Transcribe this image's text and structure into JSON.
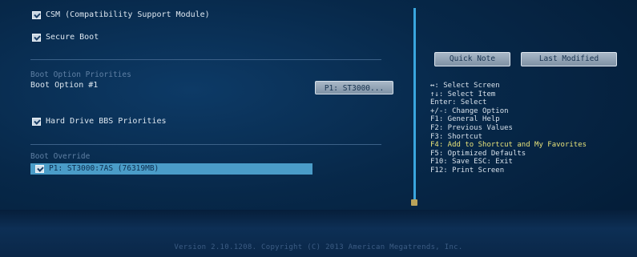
{
  "boot_menu": {
    "csm_label": "CSM (Compatibility Support Module)",
    "secure_boot_label": "Secure Boot",
    "priorities_heading": "Boot Option Priorities",
    "boot_option_1_label": "Boot Option #1",
    "boot_option_1_value": "P1: ST3000...",
    "hdd_bbs_label": "Hard Drive BBS Priorities",
    "override_heading": "Boot Override",
    "override_item": "P1: ST3000:7AS (76319MB)"
  },
  "right_panel": {
    "quick_note": "Quick Note",
    "last_modified": "Last Modified",
    "help_lines": [
      "↔: Select Screen",
      "↑↓: Select Item",
      "Enter: Select",
      "+/-: Change Option",
      "F1: General Help",
      "F2: Previous Values",
      "F3: Shortcut",
      "F4: Add to Shortcut and My Favorites",
      "F5: Optimized Defaults",
      "F10: Save  ESC: Exit",
      "F12: Print Screen"
    ]
  },
  "footer": {
    "version": "Version 2.10.1208. Copyright (C) 2013 American Megatrends, Inc."
  },
  "colors": {
    "background": "#072849",
    "accent_divider": "#3aa6de",
    "highlight": "#4a9cc8",
    "help_highlight": "#e7e27a"
  }
}
